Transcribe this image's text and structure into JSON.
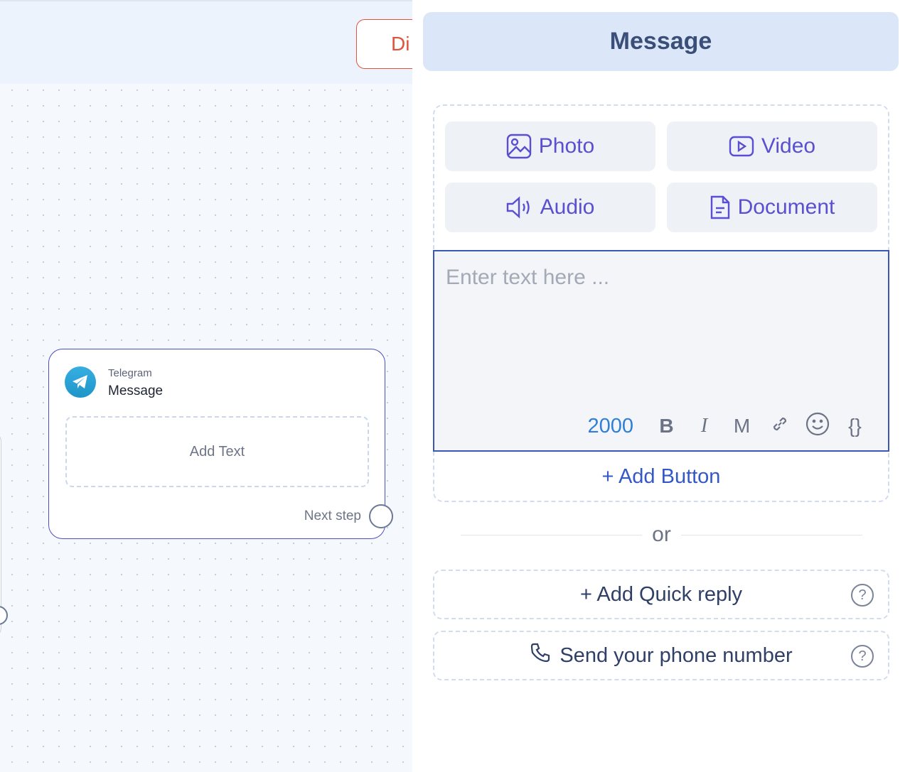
{
  "canvas": {
    "discard_button": "Di",
    "node": {
      "channel": "Telegram",
      "title": "Message",
      "add_text": "Add Text",
      "next_step": "Next step"
    }
  },
  "panel": {
    "title": "Message",
    "media_buttons": [
      {
        "label": "Photo",
        "icon": "image-icon"
      },
      {
        "label": "Video",
        "icon": "video-icon"
      },
      {
        "label": "Audio",
        "icon": "speaker-icon"
      },
      {
        "label": "Document",
        "icon": "document-icon"
      }
    ],
    "text_input": {
      "value": "",
      "placeholder": "Enter text here ..."
    },
    "toolbar": {
      "counter": "2000",
      "bold": "B",
      "italic": "I",
      "markdown": "M",
      "link_icon": "link-icon",
      "emoji_icon": "emoji-icon",
      "variables": "{}"
    },
    "add_button": "+ Add Button",
    "or_label": "or",
    "quick_reply": "+ Add Quick reply",
    "phone_number": "Send your phone number",
    "help": "?"
  },
  "colors": {
    "accent": "#5a4fd0",
    "link": "#3558c8",
    "header_bg": "#dce6f9",
    "discard": "#e0533d",
    "node_border": "#4a4fc4",
    "telegram": "#37aee2"
  }
}
